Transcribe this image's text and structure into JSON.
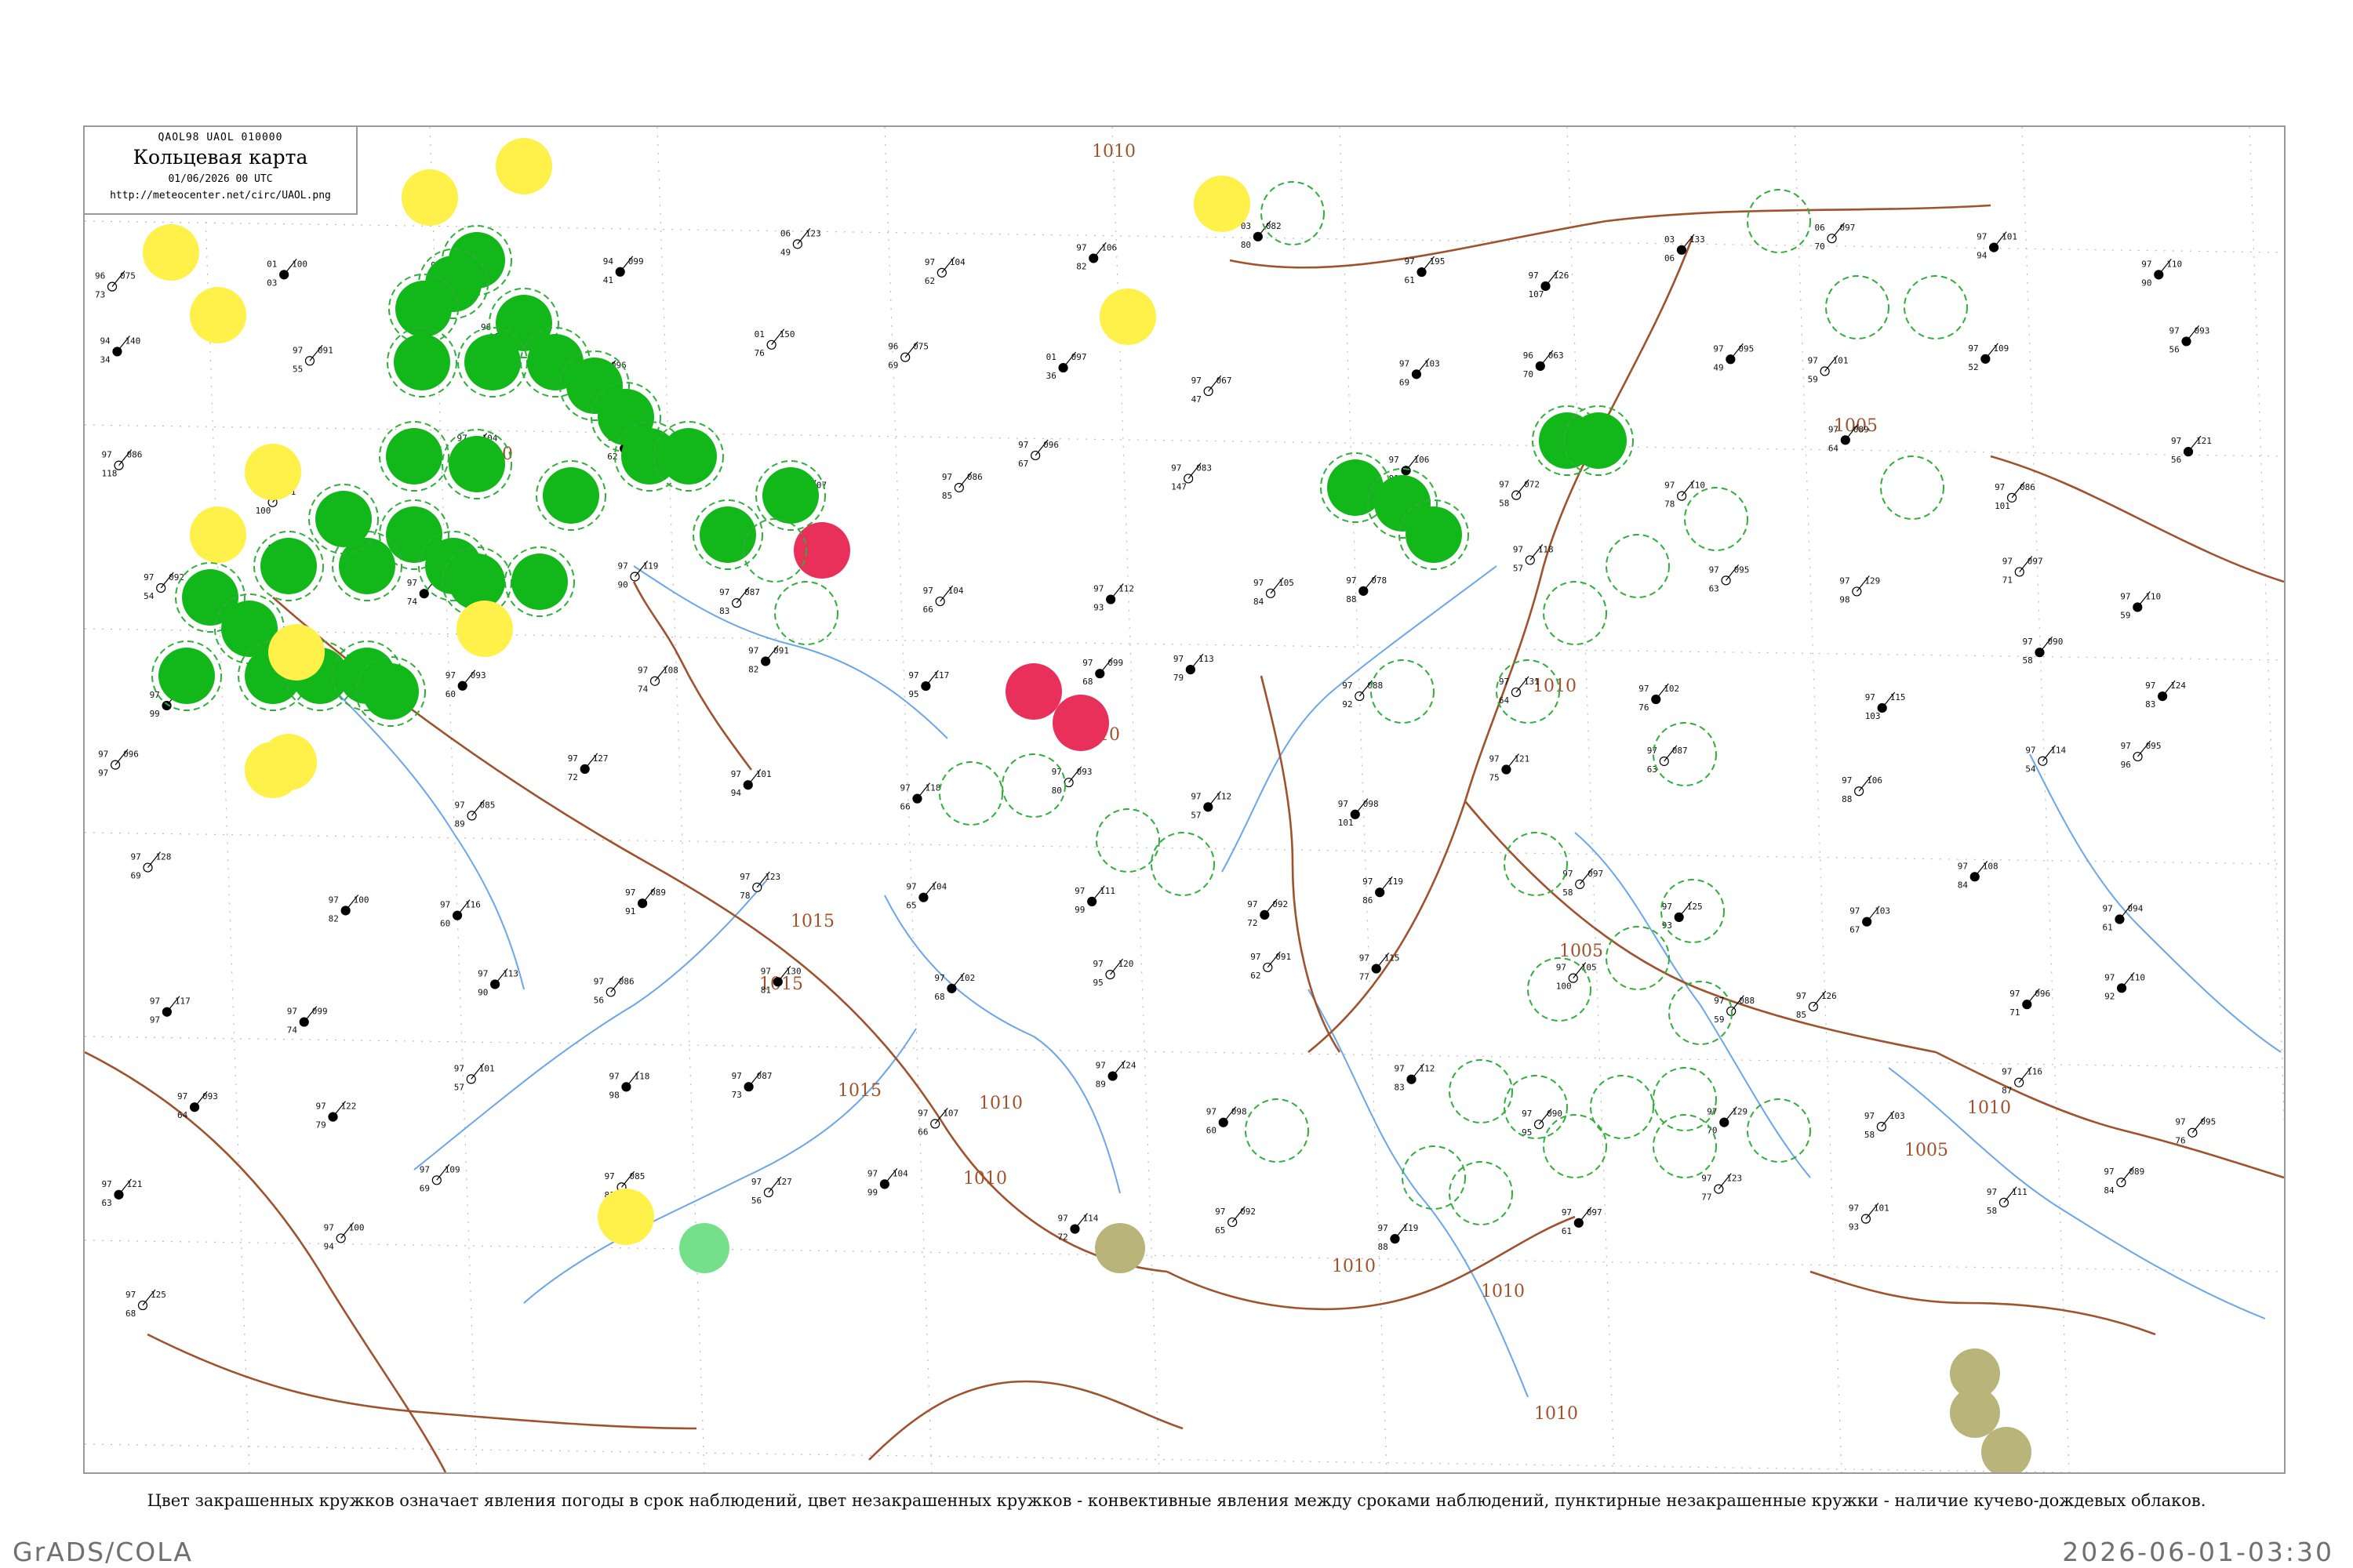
{
  "header": {
    "code_line": "QAOL98  UAOL  010000",
    "title": "Кольцевая карта",
    "date": "01/06/2026 00 UTC",
    "url": "http://meteocenter.net/circ/UAOL.png"
  },
  "caption": "Цвет закрашенных кружков означает явления погоды в срок наблюдений, цвет незакрашенных кружков - конвективные явления между сроками наблюдений, пунктирные незакрашенные кружки - наличие кучево-дождевых облаков.",
  "footer": {
    "left": "GrADS/COLA",
    "right": "2026-06-01-03:30"
  },
  "colors": {
    "isobar": "#a0522d",
    "river": "#6aa6e8",
    "rain_fill": "#12b81a",
    "drizzle_fill": "#fff04a",
    "thunder_fill": "#e8305a",
    "dust_fill": "#b8b47a",
    "ring": "#2fae3a",
    "map_border": "#9a9a9a"
  },
  "isobar_labels": [
    "1010",
    "1010",
    "1010",
    "1005",
    "1005",
    "1005",
    "1015",
    "1015",
    "1015",
    "1010",
    "1010",
    "1010",
    "1010",
    "1010",
    "1010",
    "1010"
  ],
  "stations": [
    {
      "p": "075",
      "t": "96",
      "d": "73"
    },
    {
      "p": "100",
      "t": "01",
      "d": "03"
    },
    {
      "p": "116",
      "t": "96",
      "d": "53"
    },
    {
      "p": "099",
      "t": "94",
      "d": "41"
    },
    {
      "p": "123",
      "t": "06",
      "d": "49"
    },
    {
      "p": "104",
      "t": "97",
      "d": "62"
    },
    {
      "p": "106",
      "t": "97",
      "d": "82"
    },
    {
      "p": "082",
      "t": "03",
      "d": "80"
    },
    {
      "p": "195",
      "t": "97",
      "d": "61"
    },
    {
      "p": "126",
      "t": "97",
      "d": "107"
    },
    {
      "p": "133",
      "t": "03",
      "d": "06"
    },
    {
      "p": "097",
      "t": "06",
      "d": "70"
    },
    {
      "p": "101",
      "t": "97",
      "d": "94"
    },
    {
      "p": "110",
      "t": "97",
      "d": "90"
    },
    {
      "p": "140",
      "t": "94",
      "d": "34"
    },
    {
      "p": "091",
      "t": "97",
      "d": "55"
    },
    {
      "p": "103",
      "t": "96",
      "d": "112"
    },
    {
      "p": "096",
      "t": "89",
      "d": "39"
    },
    {
      "p": "150",
      "t": "01",
      "d": "76"
    },
    {
      "p": "075",
      "t": "96",
      "d": "69"
    },
    {
      "p": "097",
      "t": "01",
      "d": "36"
    },
    {
      "p": "067",
      "t": "97",
      "d": "47"
    },
    {
      "p": "103",
      "t": "97",
      "d": "69"
    },
    {
      "p": "063",
      "t": "96",
      "d": "70"
    },
    {
      "p": "095",
      "t": "97",
      "d": "49"
    },
    {
      "p": "101",
      "t": "97",
      "d": "59"
    },
    {
      "p": "109",
      "t": "97",
      "d": "52"
    },
    {
      "p": "093",
      "t": "97",
      "d": "56"
    },
    {
      "p": "086",
      "t": "97",
      "d": "118"
    },
    {
      "p": "081",
      "t": "97",
      "d": "100"
    },
    {
      "p": "104",
      "t": "97",
      "d": "70"
    },
    {
      "p": "092",
      "t": "97",
      "d": "62"
    },
    {
      "p": "107",
      "t": "97",
      "d": "66"
    },
    {
      "p": "086",
      "t": "97",
      "d": "85"
    },
    {
      "p": "096",
      "t": "97",
      "d": "67"
    },
    {
      "p": "083",
      "t": "97",
      "d": "147"
    },
    {
      "p": "106",
      "t": "97",
      "d": "81"
    },
    {
      "p": "072",
      "t": "97",
      "d": "58"
    },
    {
      "p": "110",
      "t": "97",
      "d": "78"
    },
    {
      "p": "089",
      "t": "97",
      "d": "64"
    },
    {
      "p": "086",
      "t": "97",
      "d": "101"
    },
    {
      "p": "121",
      "t": "97",
      "d": "56"
    },
    {
      "p": "092",
      "t": "97",
      "d": "54"
    },
    {
      "p": "094",
      "t": "97",
      "d": "70"
    },
    {
      "p": "123",
      "t": "97",
      "d": "74"
    },
    {
      "p": "119",
      "t": "97",
      "d": "90"
    },
    {
      "p": "087",
      "t": "97",
      "d": "83"
    },
    {
      "p": "104",
      "t": "97",
      "d": "66"
    },
    {
      "p": "112",
      "t": "97",
      "d": "93"
    },
    {
      "p": "105",
      "t": "97",
      "d": "84"
    },
    {
      "p": "078",
      "t": "97",
      "d": "88"
    },
    {
      "p": "118",
      "t": "97",
      "d": "57"
    },
    {
      "p": "095",
      "t": "97",
      "d": "63"
    },
    {
      "p": "129",
      "t": "97",
      "d": "98"
    },
    {
      "p": "097",
      "t": "97",
      "d": "71"
    },
    {
      "p": "110",
      "t": "97",
      "d": "59"
    },
    {
      "p": "084",
      "t": "97",
      "d": "99"
    },
    {
      "p": "126",
      "t": "97",
      "d": "86"
    },
    {
      "p": "093",
      "t": "97",
      "d": "60"
    },
    {
      "p": "108",
      "t": "97",
      "d": "74"
    },
    {
      "p": "091",
      "t": "97",
      "d": "82"
    },
    {
      "p": "117",
      "t": "97",
      "d": "95"
    },
    {
      "p": "099",
      "t": "97",
      "d": "68"
    },
    {
      "p": "113",
      "t": "97",
      "d": "79"
    },
    {
      "p": "088",
      "t": "97",
      "d": "92"
    },
    {
      "p": "131",
      "t": "97",
      "d": "64"
    },
    {
      "p": "102",
      "t": "97",
      "d": "76"
    },
    {
      "p": "115",
      "t": "97",
      "d": "103"
    },
    {
      "p": "090",
      "t": "97",
      "d": "58"
    },
    {
      "p": "124",
      "t": "97",
      "d": "83"
    },
    {
      "p": "096",
      "t": "97",
      "d": "97"
    },
    {
      "p": "109",
      "t": "97",
      "d": "61"
    },
    {
      "p": "085",
      "t": "97",
      "d": "89"
    },
    {
      "p": "127",
      "t": "97",
      "d": "72"
    },
    {
      "p": "101",
      "t": "97",
      "d": "94"
    },
    {
      "p": "118",
      "t": "97",
      "d": "66"
    },
    {
      "p": "093",
      "t": "97",
      "d": "80"
    },
    {
      "p": "112",
      "t": "97",
      "d": "57"
    },
    {
      "p": "098",
      "t": "97",
      "d": "101"
    },
    {
      "p": "121",
      "t": "97",
      "d": "75"
    },
    {
      "p": "087",
      "t": "97",
      "d": "63"
    },
    {
      "p": "106",
      "t": "97",
      "d": "88"
    },
    {
      "p": "114",
      "t": "97",
      "d": "54"
    },
    {
      "p": "095",
      "t": "97",
      "d": "96"
    },
    {
      "p": "128",
      "t": "97",
      "d": "69"
    },
    {
      "p": "100",
      "t": "97",
      "d": "82"
    },
    {
      "p": "116",
      "t": "97",
      "d": "60"
    },
    {
      "p": "089",
      "t": "97",
      "d": "91"
    },
    {
      "p": "123",
      "t": "97",
      "d": "78"
    },
    {
      "p": "104",
      "t": "97",
      "d": "65"
    },
    {
      "p": "111",
      "t": "97",
      "d": "99"
    },
    {
      "p": "092",
      "t": "97",
      "d": "72"
    },
    {
      "p": "119",
      "t": "97",
      "d": "86"
    },
    {
      "p": "097",
      "t": "97",
      "d": "58"
    },
    {
      "p": "125",
      "t": "97",
      "d": "93"
    },
    {
      "p": "103",
      "t": "97",
      "d": "67"
    },
    {
      "p": "108",
      "t": "97",
      "d": "84"
    },
    {
      "p": "094",
      "t": "97",
      "d": "61"
    },
    {
      "p": "117",
      "t": "97",
      "d": "97"
    },
    {
      "p": "099",
      "t": "97",
      "d": "74"
    },
    {
      "p": "113",
      "t": "97",
      "d": "90"
    },
    {
      "p": "086",
      "t": "97",
      "d": "56"
    },
    {
      "p": "130",
      "t": "97",
      "d": "81"
    },
    {
      "p": "102",
      "t": "97",
      "d": "68"
    },
    {
      "p": "120",
      "t": "97",
      "d": "95"
    },
    {
      "p": "091",
      "t": "97",
      "d": "62"
    },
    {
      "p": "115",
      "t": "97",
      "d": "77"
    },
    {
      "p": "105",
      "t": "97",
      "d": "100"
    },
    {
      "p": "088",
      "t": "97",
      "d": "59"
    },
    {
      "p": "126",
      "t": "97",
      "d": "85"
    },
    {
      "p": "096",
      "t": "97",
      "d": "71"
    },
    {
      "p": "110",
      "t": "97",
      "d": "92"
    },
    {
      "p": "093",
      "t": "97",
      "d": "64"
    },
    {
      "p": "122",
      "t": "97",
      "d": "79"
    },
    {
      "p": "101",
      "t": "97",
      "d": "57"
    },
    {
      "p": "118",
      "t": "97",
      "d": "98"
    },
    {
      "p": "087",
      "t": "97",
      "d": "73"
    },
    {
      "p": "107",
      "t": "97",
      "d": "66"
    },
    {
      "p": "124",
      "t": "97",
      "d": "89"
    },
    {
      "p": "098",
      "t": "97",
      "d": "60"
    },
    {
      "p": "112",
      "t": "97",
      "d": "83"
    },
    {
      "p": "090",
      "t": "97",
      "d": "95"
    },
    {
      "p": "129",
      "t": "97",
      "d": "70"
    },
    {
      "p": "103",
      "t": "97",
      "d": "58"
    },
    {
      "p": "116",
      "t": "97",
      "d": "87"
    },
    {
      "p": "095",
      "t": "97",
      "d": "76"
    },
    {
      "p": "121",
      "t": "97",
      "d": "63"
    },
    {
      "p": "100",
      "t": "97",
      "d": "94"
    },
    {
      "p": "109",
      "t": "97",
      "d": "69"
    },
    {
      "p": "085",
      "t": "97",
      "d": "81"
    },
    {
      "p": "127",
      "t": "97",
      "d": "56"
    },
    {
      "p": "104",
      "t": "97",
      "d": "99"
    },
    {
      "p": "114",
      "t": "97",
      "d": "72"
    },
    {
      "p": "092",
      "t": "97",
      "d": "65"
    },
    {
      "p": "119",
      "t": "97",
      "d": "88"
    },
    {
      "p": "097",
      "t": "97",
      "d": "61"
    },
    {
      "p": "123",
      "t": "97",
      "d": "77"
    },
    {
      "p": "101",
      "t": "97",
      "d": "93"
    },
    {
      "p": "111",
      "t": "97",
      "d": "58"
    },
    {
      "p": "089",
      "t": "97",
      "d": "84"
    },
    {
      "p": "125",
      "t": "97",
      "d": "68"
    }
  ]
}
